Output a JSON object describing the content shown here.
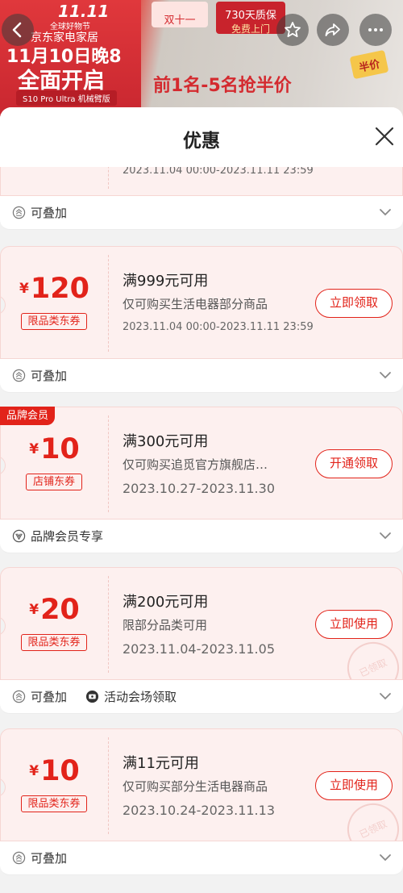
{
  "banner": {
    "event": "11.11",
    "event_sub": "全球好物节",
    "brand": "京东家电家居",
    "line1": "11月10日晚8",
    "line2": "全面开启",
    "model": "S10 Pro Ultra 机械臂版",
    "tag1": "双十一",
    "tag2_line1": "730天质保",
    "tag2_line2": "免费上门",
    "half_price": "前1名-5名抢半价",
    "half_badge": "半价"
  },
  "nav": {
    "back_icon": "chevron-left-icon",
    "favorite_icon": "star-icon",
    "share_icon": "share-arrow-icon",
    "more_icon": "more-icon"
  },
  "sheet": {
    "title": "优惠",
    "close_icon": "close-icon"
  },
  "partial_coupon": {
    "date": "2023.11.04 00:00-2023.11.11 23:59",
    "feature": "可叠加"
  },
  "coupons": [
    {
      "currency": "¥",
      "amount": "120",
      "type": "限品类东券",
      "title": "满999元可用",
      "desc": "仅可购买生活电器部分商品",
      "date": "2023.11.04 00:00-2023.11.11 23:59",
      "button": "立即领取",
      "features": [
        "可叠加"
      ]
    },
    {
      "badge": "品牌会员",
      "currency": "¥",
      "amount": "10",
      "type": "店铺东券",
      "title": "满300元可用",
      "desc": "仅可购买追觅官方旗舰店…",
      "date": "2023.10.27-2023.11.30",
      "button": "开通领取",
      "features": [
        "品牌会员专享"
      ]
    },
    {
      "currency": "¥",
      "amount": "20",
      "type": "限品类东券",
      "title": "满200元可用",
      "desc": "限部分品类可用",
      "date": "2023.11.04-2023.11.05",
      "button": "立即使用",
      "stamp": "已领取",
      "features": [
        "可叠加",
        "活动会场领取"
      ]
    },
    {
      "currency": "¥",
      "amount": "10",
      "type": "限品类东券",
      "title": "满11元可用",
      "desc": "仅可购买部分生活电器商品",
      "date": "2023.10.24-2023.11.13",
      "button": "立即使用",
      "stamp": "已领取",
      "features": [
        "可叠加"
      ]
    }
  ],
  "colors": {
    "accent": "#e2231a",
    "card_bg": "#fdf0ef",
    "page_bg": "#f2f2f2"
  }
}
